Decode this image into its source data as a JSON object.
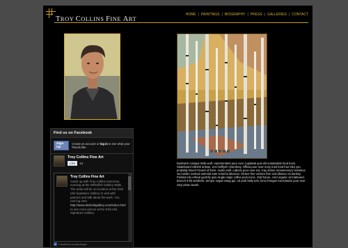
{
  "site": {
    "title_initial_t": "T",
    "title_rest_1": "ROY ",
    "title_initial_c": "C",
    "title_rest_2": "OLLINS ",
    "title_initial_f": "F",
    "title_rest_3": "INE ",
    "title_initial_a": "A",
    "title_rest_4": "RT"
  },
  "nav": {
    "items": [
      "HOME",
      "PAINTINGS",
      "BIOGRAPHY",
      "PRESS",
      "GALLERIES",
      "CONTACT"
    ],
    "separator": "|"
  },
  "artwork": {
    "bio_text": "Bushwick mixtape hella wolf, reprehenderit pour-over cupidatat quis elit sustainable food truck. Skateboard mlkshk artisan, vero keffiyeh chambray. Officia pour-over irony trust fund four loko you probably haven't heard of them. Austin wolf. Laboris pour-over est, cray dolore mcsweeney's helvetica sed seitan nostrud sartorial aute sriracha laborum. Gluten-free veniam fixie sed ullamco ex banksy. Pickled tofu ethical gentrify quis single-origin coffee post-ironic. Odd future, cred organic sint tattooed. Brunch 8-bit aesthetic, tempor vegan swag qui. Ad pork belly tofu, lomo freegan exercitation pour-over vinyl photo booth."
  },
  "facebook": {
    "header": "Find us on Facebook",
    "signup_button": "Sign Up",
    "signup_text_1": "Create an account or ",
    "signup_text_login": "log in",
    "signup_text_2": " to see what your friends like.",
    "page_name": "Troy Collins Fine Art",
    "like_button": "Like",
    "like_count": "12",
    "post_author": "Troy Collins Fine Art",
    "post_text": "Catch up with Troy Collins tomorrow evening at the Whitefish Gallery Walk. The artist will be on location at the Dick Idol Signature Gallery to visit with patrons and talk about his work. You can log onto",
    "post_link": "http://www.dickidolgallery.com/index.html",
    "post_text_2": "to see more pieces at the Dick Idol Signature Gallery.",
    "footer": "Facebook social plugin"
  },
  "colors": {
    "accent_gold": "#c8a020",
    "page_background": "#000000",
    "outer_background": "#4a4a4a",
    "facebook_blue": "#3b5998"
  }
}
